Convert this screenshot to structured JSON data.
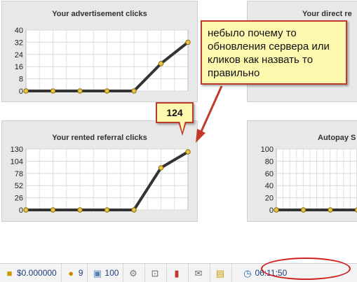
{
  "panels": {
    "ad_clicks": {
      "title": "Your advertisement clicks"
    },
    "direct_referral": {
      "title": "Your direct re"
    },
    "rented_referral": {
      "title": "Your rented referral clicks"
    },
    "autopay": {
      "title": "Autopay S"
    }
  },
  "annotation": {
    "note": "небыло почему то обновления сервера или кликов как назвать то правильно",
    "callout": "124"
  },
  "statusbar": {
    "balance": "$0.000000",
    "direct_refs": "9",
    "rented_refs": "100",
    "clock": "06:11:50"
  },
  "colors": {
    "line": "#333333",
    "point": "#e8c44a",
    "annotation_border": "#c0392b",
    "note_bg": "#fff9b0"
  },
  "icons": [
    "money-icon",
    "users-icon",
    "rented-users-icon",
    "gear-icon",
    "cart-icon",
    "stats-icon",
    "mail-icon",
    "lock-icon",
    "clock-icon"
  ],
  "chart_data": [
    {
      "type": "line",
      "title": "Your advertisement clicks",
      "y_ticks": [
        "0",
        "8",
        "16",
        "24",
        "32",
        "40"
      ],
      "ylim": [
        0,
        40
      ],
      "values": [
        0,
        0,
        0,
        0,
        0,
        18,
        32
      ]
    },
    {
      "type": "line",
      "title": "Your rented referral clicks",
      "y_ticks": [
        "0",
        "26",
        "52",
        "78",
        "104",
        "130"
      ],
      "ylim": [
        0,
        130
      ],
      "values": [
        0,
        0,
        0,
        0,
        0,
        90,
        124
      ]
    },
    {
      "type": "line",
      "title": "Autopay S",
      "y_ticks": [
        "0",
        "20",
        "40",
        "60",
        "80",
        "100"
      ],
      "ylim": [
        0,
        100
      ],
      "values": [
        0,
        0,
        0,
        0
      ]
    }
  ]
}
